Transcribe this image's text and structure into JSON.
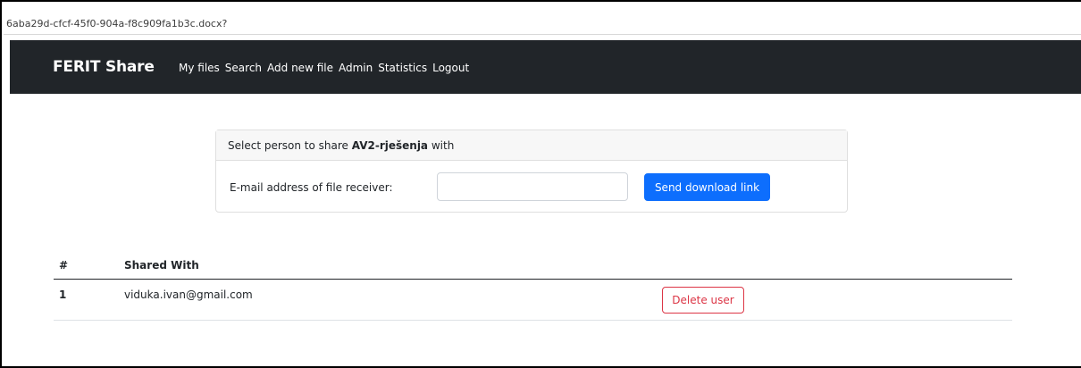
{
  "browser": {
    "url": "6aba29d-cfcf-45f0-904a-f8c909fa1b3c.docx?"
  },
  "navbar": {
    "brand": "FERIT Share",
    "links": [
      "My files",
      "Search",
      "Add new file",
      "Admin",
      "Statistics",
      "Logout"
    ]
  },
  "share_card": {
    "header_prefix": "Select person to share ",
    "file_name": "AV2-rješenja",
    "header_suffix": " with",
    "email_label": "E-mail address of file receiver:",
    "email_value": "",
    "email_placeholder": "",
    "send_button": "Send download link"
  },
  "shared_table": {
    "columns": [
      "#",
      "Shared With"
    ],
    "rows": [
      {
        "num": "1",
        "email": "viduka.ivan@gmail.com",
        "action": "Delete user"
      }
    ]
  },
  "colors": {
    "navbar_bg": "#212529",
    "primary": "#0d6efd",
    "danger": "#dc3545"
  }
}
